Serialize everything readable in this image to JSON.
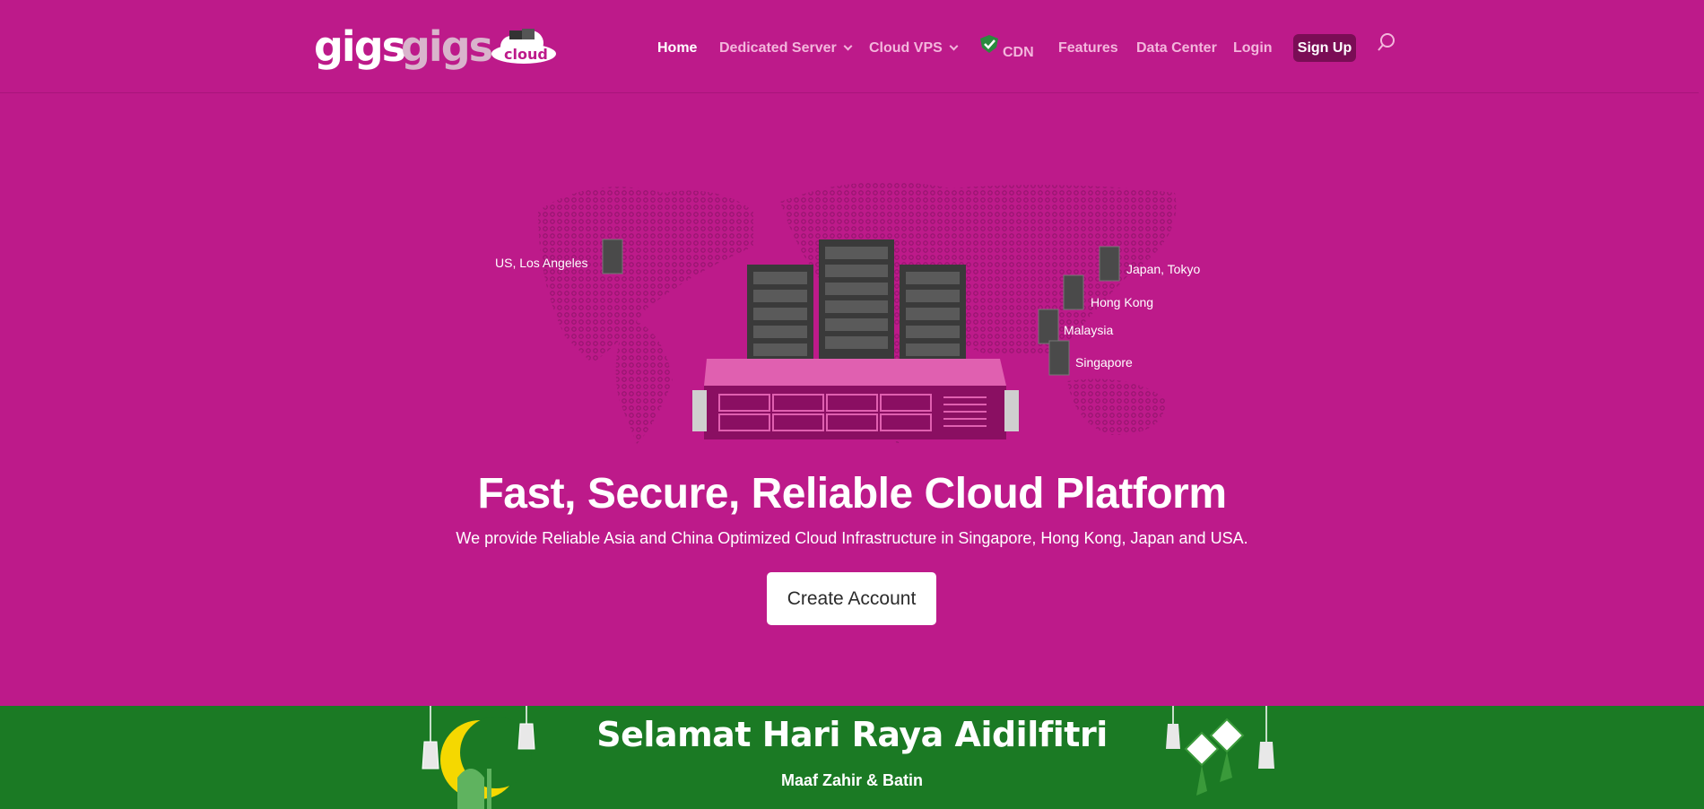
{
  "brand": {
    "logo_part1": "gigs",
    "logo_part2": "gigs",
    "logo_badge": "cloud"
  },
  "nav": {
    "home": "Home",
    "dedicated": "Dedicated Server",
    "cloud_vps": "Cloud VPS",
    "cdn": "CDN",
    "features": "Features",
    "data_center": "Data Center",
    "login": "Login",
    "signup": "Sign Up"
  },
  "hero": {
    "locations": [
      "US, Los Angeles",
      "Japan, Tokyo",
      "Hong Kong",
      "Malaysia",
      "Singapore"
    ],
    "title": "Fast, Secure, Reliable Cloud Platform",
    "subtitle": "We provide Reliable Asia and China Optimized Cloud Infrastructure in Singapore, Hong Kong, Japan and USA.",
    "cta": "Create Account"
  },
  "banner": {
    "title": "Selamat Hari Raya Aidilfitri",
    "subtitle": "Maaf Zahir & Batin"
  },
  "colors": {
    "background": "#bd1a8a",
    "signup_bg": "#7a0d55",
    "banner_green": "#1b7a24",
    "nav_text": "#f3b6dc"
  },
  "icons": [
    "search-icon",
    "chevron-down-icon",
    "cdn-shield-icon",
    "server-icon",
    "crescent-moon-icon",
    "lantern-icon",
    "ketupat-icon"
  ]
}
